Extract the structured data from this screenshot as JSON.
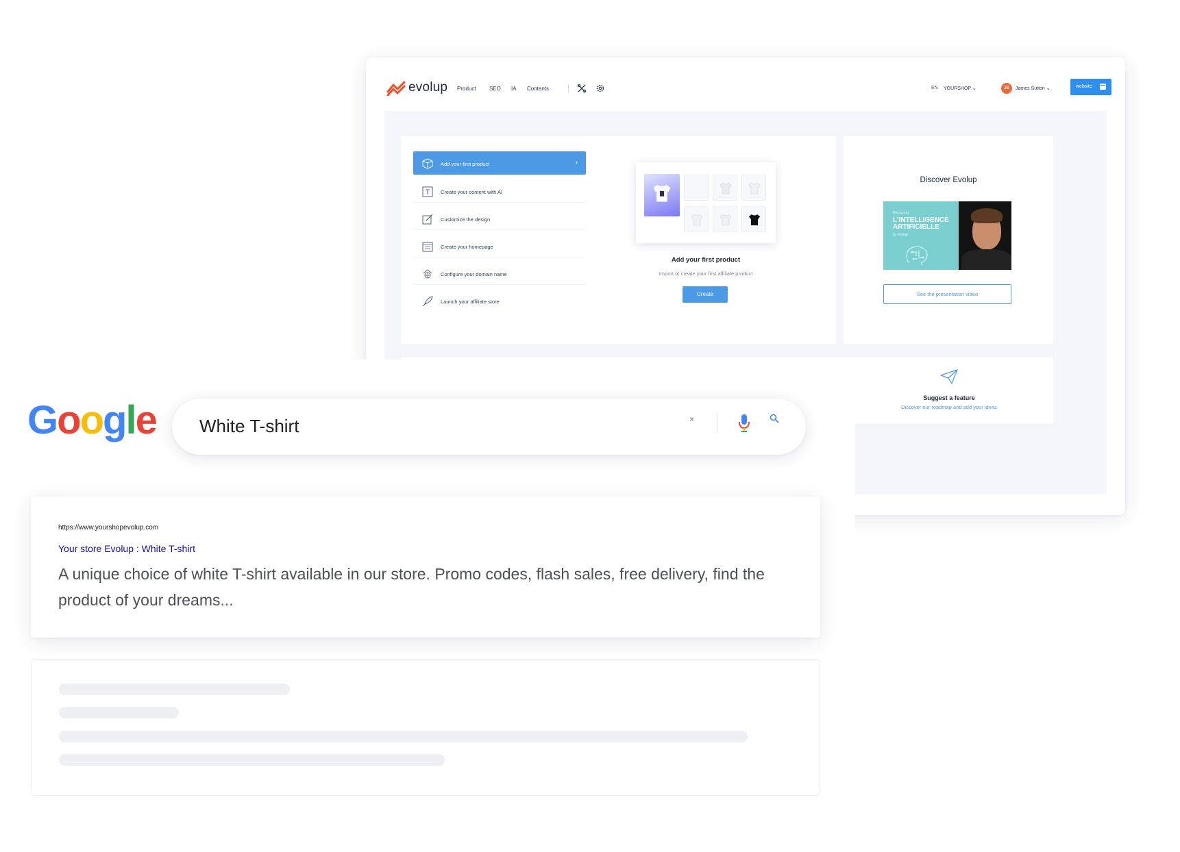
{
  "dashboard": {
    "brand": "evolup",
    "nav": [
      "Product",
      "SEO",
      "IA",
      "Contents"
    ],
    "language": "EN",
    "shop": "YOURSHOP",
    "user_initials": "JS",
    "user_name": "James Sutton",
    "website_button": "website",
    "steps": [
      {
        "label": "Add your first product",
        "icon": "box-icon",
        "active": true
      },
      {
        "label": "Create your content with AI",
        "icon": "text-icon",
        "active": false
      },
      {
        "label": "Customize the design",
        "icon": "design-icon",
        "active": false
      },
      {
        "label": "Create your homepage",
        "icon": "homepage-icon",
        "active": false
      },
      {
        "label": "Configure your domain name",
        "icon": "domain-icon",
        "active": false
      },
      {
        "label": "Launch your affiliate store",
        "icon": "rocket-icon",
        "active": false
      }
    ],
    "product_card": {
      "title": "Add your first product",
      "subtitle": "Import or create your first affiliate product",
      "button": "Create"
    },
    "discover_card": {
      "title": "Discover Evolup",
      "video_kicker": "Découvrez",
      "video_title": "L'INTELLIGENCE ARTIFICIELLE",
      "video_by": "by Evolup",
      "button": "See the presentation video"
    },
    "suggest_card": {
      "title": "Suggest a feature",
      "subtitle": "Discover our roadmap and add your ideas"
    },
    "colors": {
      "accent": "#4c9ae6",
      "brand_orange": "#ef4f2d"
    }
  },
  "google": {
    "logo": [
      "G",
      "o",
      "o",
      "g",
      "l",
      "e"
    ],
    "query": "White T-shirt",
    "clear_symbol": "×",
    "result": {
      "url": "https://www.yourshopevolup.com",
      "title": "Your store Evolup : White T-shirt",
      "description": "A unique choice of white T-shirt available in our store. Promo codes, flash sales, free delivery, find the product of your dreams..."
    }
  }
}
